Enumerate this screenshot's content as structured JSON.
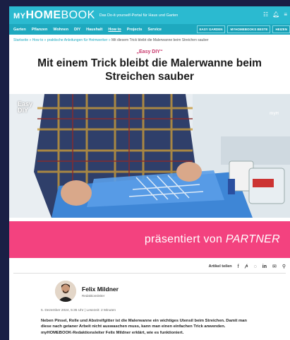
{
  "header": {
    "logo_my": "MY",
    "logo_home": "HOME",
    "logo_book": "BOOK",
    "tagline": "Das Do-it-yourself-Portal für Haus und Garten",
    "nav": [
      "Garten",
      "Pflanzen",
      "Wohnen",
      "DIY",
      "Haushalt",
      "How to",
      "Projects",
      "Service"
    ],
    "nav_active": "How to",
    "nav_right": [
      "EASY GARDEN",
      "MYHOMEBOOKS BESTE",
      "HEIZEN"
    ],
    "icons": [
      "menu-icon",
      "bell-icon",
      "hamburger-icon"
    ]
  },
  "breadcrumb": {
    "items": [
      "Startseite",
      "How to",
      "praktische Anleitungen für Heimwerker"
    ],
    "separator": "»",
    "current": "Mit diesem Trick bleibt die Malerwanne beim Streichen sauber"
  },
  "article": {
    "kicker": "„Easy DIY“",
    "title": "Mit einem Trick bleibt die Malerwanne beim Streichen sauber",
    "hero_badge_line1": "Easy",
    "hero_badge_line2": "DIY",
    "hero_brand": "myH",
    "partner_prefix": "präsentiert von ",
    "partner_name": "PARTNER",
    "share_label": "Artikel teilen",
    "share_icons": [
      "facebook-icon",
      "pinterest-icon",
      "whatsapp-icon",
      "linkedin-icon",
      "mail-icon",
      "link-icon"
    ],
    "author_name": "Felix Mildner",
    "author_role": "Redaktionsleiter",
    "meta": "5. Dezember 2024, 5:35 Uhr | Lesezeit: 2 Minuten",
    "teaser": "Neben Pinsel, Rolle und Abstreifgitter ist die Malerwanne ein wichtiges Utensil beim Streichen. Damit man diese nach getaner Arbeit nicht auswaschen muss, kann man einen einfachen Trick anwenden. myHOMEBOOK-Redaktionsleiter Felix Mildner erklärt, wie es funktioniert."
  },
  "colors": {
    "brand": "#2bbad0",
    "nav": "#1ea9bf",
    "kicker": "#c8366a",
    "partner_band": "#f3427f",
    "page_bg": "#1a1f45"
  }
}
